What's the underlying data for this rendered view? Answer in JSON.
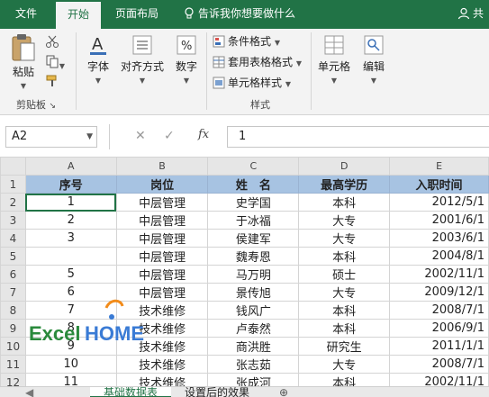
{
  "tabs": [
    {
      "label": "文件"
    },
    {
      "label": "开始"
    },
    {
      "label": "页面布局"
    }
  ],
  "tell_me": "告诉我你想要做什么",
  "share": "共",
  "ribbon": {
    "clipboard": {
      "paste": "粘贴",
      "group": "剪贴板"
    },
    "font": "字体",
    "alignment": "对齐方式",
    "number": "数字",
    "styles": {
      "conditional": "条件格式",
      "table": "套用表格格式",
      "cell_style": "单元格样式",
      "group": "样式"
    },
    "cells": "单元格",
    "editing": "编辑"
  },
  "formula_bar": {
    "name_box": "A2",
    "fx": "fx",
    "value": "1"
  },
  "columns": [
    "A",
    "B",
    "C",
    "D",
    "E"
  ],
  "header_row": {
    "no": "序号",
    "post": "岗位",
    "name": "姓　名",
    "edu": "最高学历",
    "date": "入职时间"
  },
  "rows": [
    {
      "n": "2",
      "no": "1",
      "post": "中层管理",
      "name": "史学国",
      "edu": "本科",
      "date": "2012/5/1"
    },
    {
      "n": "3",
      "no": "2",
      "post": "中层管理",
      "name": "于冰福",
      "edu": "大专",
      "date": "2001/6/1"
    },
    {
      "n": "4",
      "no": "3",
      "post": "中层管理",
      "name": "侯建军",
      "edu": "大专",
      "date": "2003/6/1"
    },
    {
      "n": "5",
      "no": "",
      "post": "中层管理",
      "name": "魏寿恩",
      "edu": "本科",
      "date": "2004/8/1"
    },
    {
      "n": "6",
      "no": "5",
      "post": "中层管理",
      "name": "马万明",
      "edu": "硕士",
      "date": "2002/11/1"
    },
    {
      "n": "7",
      "no": "6",
      "post": "中层管理",
      "name": "景传旭",
      "edu": "大专",
      "date": "2009/12/1"
    },
    {
      "n": "8",
      "no": "7",
      "post": "技术维修",
      "name": "钱风广",
      "edu": "本科",
      "date": "2008/7/1"
    },
    {
      "n": "9",
      "no": "8",
      "post": "技术维修",
      "name": "卢泰然",
      "edu": "本科",
      "date": "2006/9/1"
    },
    {
      "n": "10",
      "no": "9",
      "post": "技术维修",
      "name": "商洪胜",
      "edu": "研究生",
      "date": "2011/1/1"
    },
    {
      "n": "11",
      "no": "10",
      "post": "技术维修",
      "name": "张志茹",
      "edu": "大专",
      "date": "2008/7/1"
    },
    {
      "n": "12",
      "no": "11",
      "post": "技术维修",
      "name": "张成河",
      "edu": "本科",
      "date": "2002/11/1"
    }
  ],
  "header_row_num": "1",
  "sheet_tabs": [
    {
      "label": "基础数据表"
    },
    {
      "label": "设置后的效果"
    }
  ],
  "watermark": {
    "text1": "Excel",
    "text2": "HOME"
  },
  "colors": {
    "ribbon": "#217346",
    "header_fill": "#a7c3e2",
    "logo_green": "#2a8a3c",
    "logo_blue": "#3a7bd5",
    "logo_orange": "#f28c1b"
  }
}
